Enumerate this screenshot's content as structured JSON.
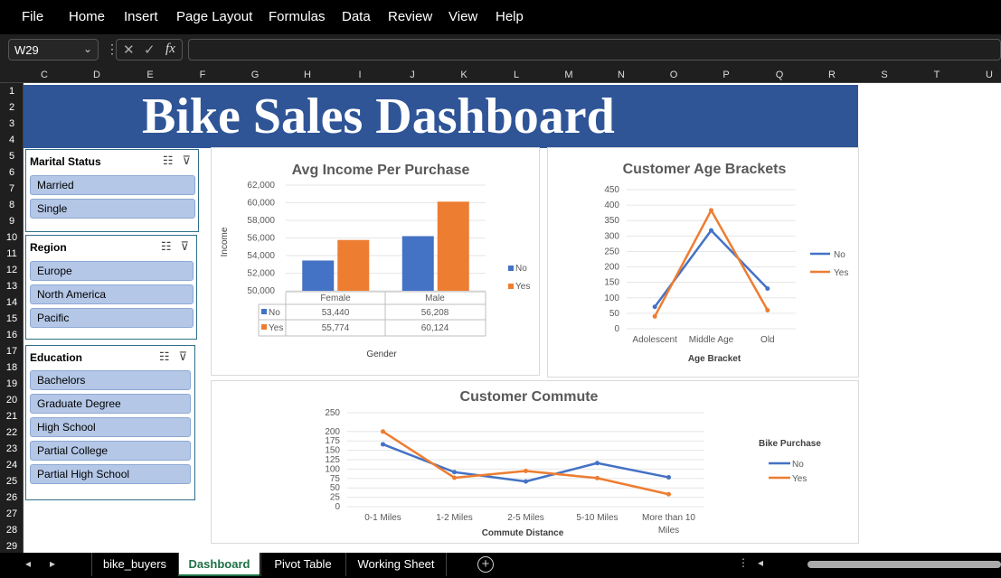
{
  "menu": [
    "File",
    "Home",
    "Insert",
    "Page Layout",
    "Formulas",
    "Data",
    "Review",
    "View",
    "Help"
  ],
  "formula_bar": {
    "name_box": "W29",
    "fx_label": "fx",
    "formula": ""
  },
  "columns": [
    "C",
    "D",
    "E",
    "F",
    "G",
    "H",
    "I",
    "J",
    "K",
    "L",
    "M",
    "N",
    "O",
    "P",
    "Q",
    "R",
    "S",
    "T",
    "U"
  ],
  "rows": [
    "1",
    "2",
    "3",
    "4",
    "5",
    "6",
    "7",
    "8",
    "9",
    "10",
    "11",
    "12",
    "13",
    "14",
    "15",
    "16",
    "17",
    "18",
    "19",
    "20",
    "21",
    "22",
    "23",
    "24",
    "25",
    "26",
    "27",
    "28",
    "29"
  ],
  "dashboard_title": "Bike Sales Dashboard",
  "slicers": [
    {
      "title": "Marital Status",
      "items": [
        "Married",
        "Single"
      ]
    },
    {
      "title": "Region",
      "items": [
        "Europe",
        "North America",
        "Pacific"
      ]
    },
    {
      "title": "Education",
      "items": [
        "Bachelors",
        "Graduate Degree",
        "High School",
        "Partial College",
        "Partial High School"
      ]
    }
  ],
  "chart_data": [
    {
      "type": "bar",
      "title": "Avg Income Per Purchase",
      "xlabel": "Gender",
      "ylabel": "Income",
      "categories": [
        "Female",
        "Male"
      ],
      "series": [
        {
          "name": "No",
          "values": [
            53440,
            56208
          ],
          "labels": [
            "53,440",
            "56,208"
          ],
          "color": "#4472c4"
        },
        {
          "name": "Yes",
          "values": [
            55774,
            60124
          ],
          "labels": [
            "55,774",
            "60,124"
          ],
          "color": "#ed7d31"
        }
      ],
      "ylim": [
        50000,
        62000
      ],
      "yticks": [
        "50,000",
        "52,000",
        "54,000",
        "56,000",
        "58,000",
        "60,000",
        "62,000"
      ],
      "legend": "right",
      "data_table": true
    },
    {
      "type": "line",
      "title": "Customer Age Brackets",
      "xlabel": "Age Bracket",
      "categories": [
        "Adolescent",
        "Middle Age",
        "Old"
      ],
      "series": [
        {
          "name": "No",
          "values": [
            71,
            318,
            130
          ],
          "color": "#4472c4"
        },
        {
          "name": "Yes",
          "values": [
            40,
            383,
            60
          ],
          "color": "#ed7d31"
        }
      ],
      "ylim": [
        0,
        450
      ],
      "yticks": [
        "0",
        "50",
        "100",
        "150",
        "200",
        "250",
        "300",
        "350",
        "400",
        "450"
      ],
      "legend": "right"
    },
    {
      "type": "line",
      "title": "Customer Commute",
      "xlabel": "Commute Distance",
      "legend_title": "Bike Purchase",
      "categories": [
        "0-1 Miles",
        "1-2 Miles",
        "2-5 Miles",
        "5-10 Miles",
        "More than 10 Miles"
      ],
      "series": [
        {
          "name": "No",
          "values": [
            166,
            92,
            67,
            116,
            78
          ],
          "color": "#4472c4"
        },
        {
          "name": "Yes",
          "values": [
            200,
            77,
            95,
            76,
            33
          ],
          "color": "#ed7d31"
        }
      ],
      "ylim": [
        0,
        250
      ],
      "yticks": [
        "0",
        "25",
        "50",
        "75",
        "100",
        "125",
        "150",
        "175",
        "200",
        "250"
      ],
      "legend": "right"
    }
  ],
  "sheet_tabs": [
    "bike_buyers",
    "Dashboard",
    "Pivot Table",
    "Working Sheet"
  ],
  "active_tab": "Dashboard"
}
